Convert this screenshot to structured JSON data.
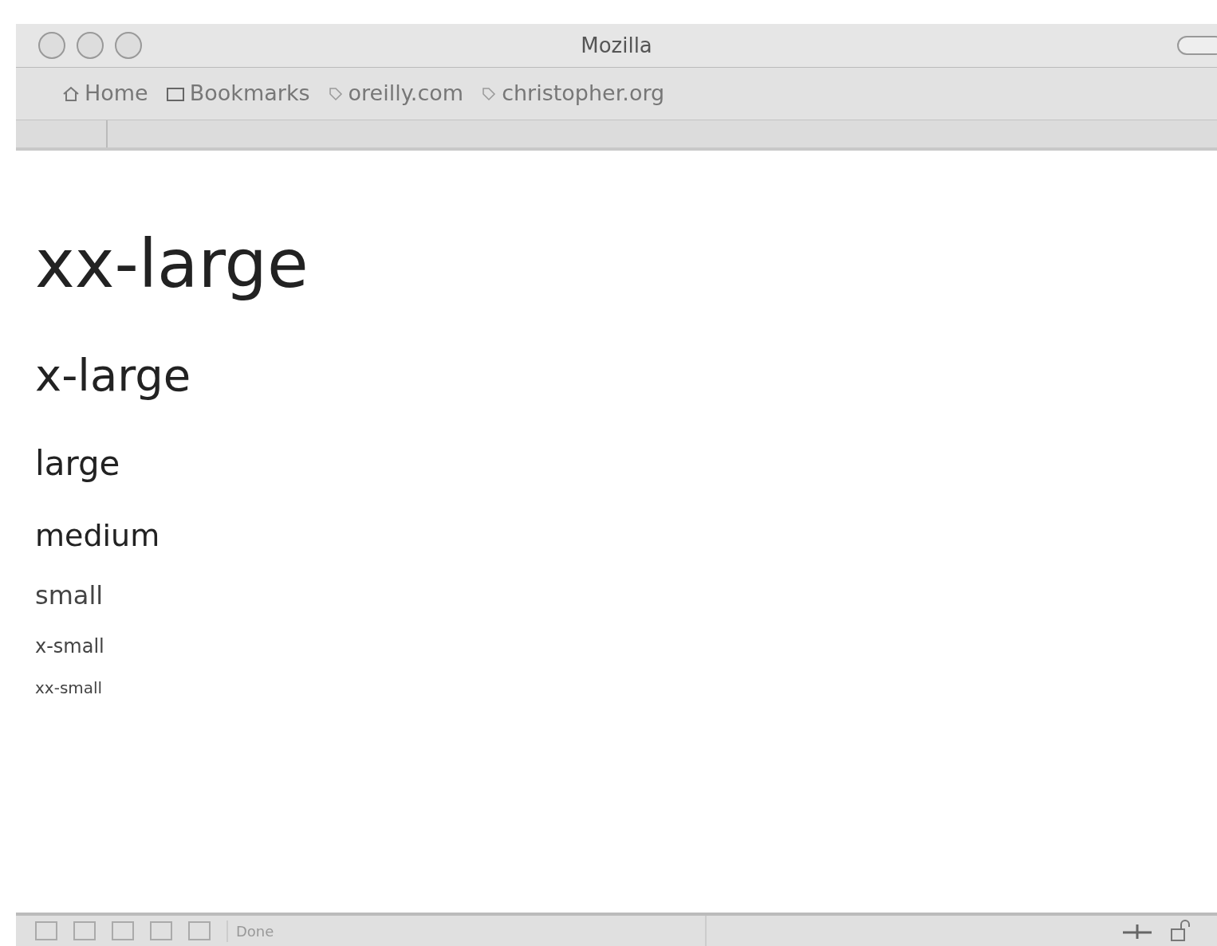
{
  "window": {
    "title": "Mozilla"
  },
  "bookmarks_bar": {
    "items": [
      {
        "kind": "home",
        "label": "Home"
      },
      {
        "kind": "folder",
        "label": "Bookmarks"
      },
      {
        "kind": "link",
        "label": "oreilly.com"
      },
      {
        "kind": "link",
        "label": "christopher.org"
      }
    ]
  },
  "content": {
    "lines": [
      "xx-large",
      "x-large",
      "large",
      "medium",
      "small",
      "x-small",
      "xx-small"
    ]
  },
  "status_bar": {
    "text": "Done"
  }
}
